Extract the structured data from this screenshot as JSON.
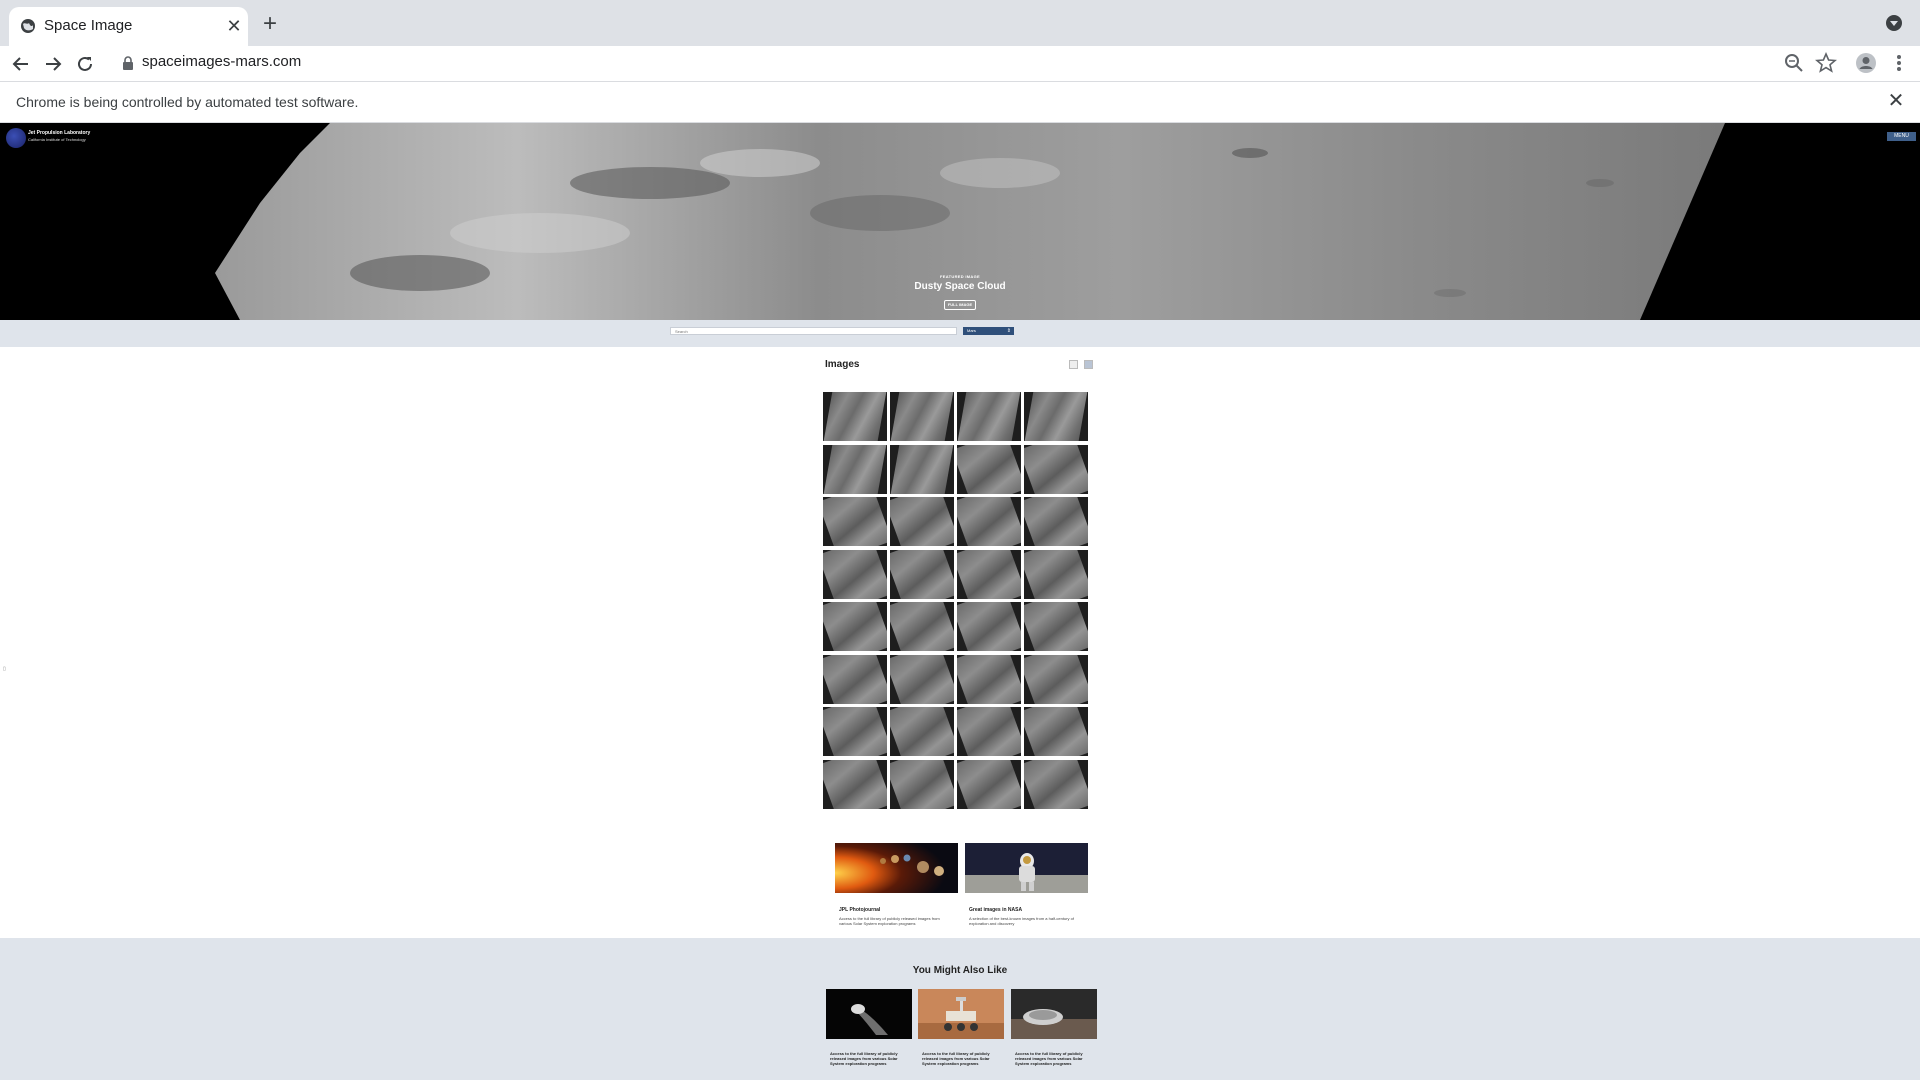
{
  "browser": {
    "tab_title": "Space Image",
    "url": "spaceimages-mars.com",
    "infobar_text": "Chrome is being controlled by automated test software."
  },
  "site": {
    "org_name": "Jet Propulsion Laboratory",
    "org_sub": "California Institute of Technology",
    "menu_label": "MENU"
  },
  "hero": {
    "label": "FEATURED IMAGE",
    "title": "Dusty Space Cloud",
    "button": "FULL IMAGE"
  },
  "search": {
    "placeholder": "Search",
    "select_value": "Mars"
  },
  "images": {
    "heading": "Images",
    "grid": [
      [
        "plain",
        "plain",
        "plain",
        "plain"
      ],
      [
        "plain",
        "plain",
        "tilt",
        "tilt"
      ],
      [
        "tilt",
        "tilt",
        "tilt",
        "tilt"
      ],
      [
        "tilt",
        "tilt",
        "tilt",
        "tilt"
      ],
      [
        "tilt",
        "tilt",
        "tilt",
        "tilt"
      ],
      [
        "tilt",
        "tilt",
        "tilt",
        "tilt"
      ],
      [
        "tilt",
        "tilt",
        "tilt",
        "tilt"
      ],
      [
        "tilt",
        "tilt",
        "tilt",
        "tilt"
      ]
    ]
  },
  "related": [
    {
      "title": "JPL Photojournal",
      "desc": "Access to the full library of publicly released images from various Solar System exploration programs"
    },
    {
      "title": "Great images in NASA",
      "desc": "A selection of the best-known images from a half-century of exploration and discovery"
    }
  ],
  "also": {
    "heading": "You Might Also Like",
    "cards": [
      {
        "desc": "Access to the full library of publicly released images from various Solar System exploration programs"
      },
      {
        "desc": "Access to the full library of publicly released images from various Solar System exploration programs"
      },
      {
        "desc": "Access to the full library of publicly released images from various Solar System exploration programs"
      }
    ]
  },
  "colors": {
    "band": "#dfe4eb",
    "accent": "#2f4f7a"
  }
}
